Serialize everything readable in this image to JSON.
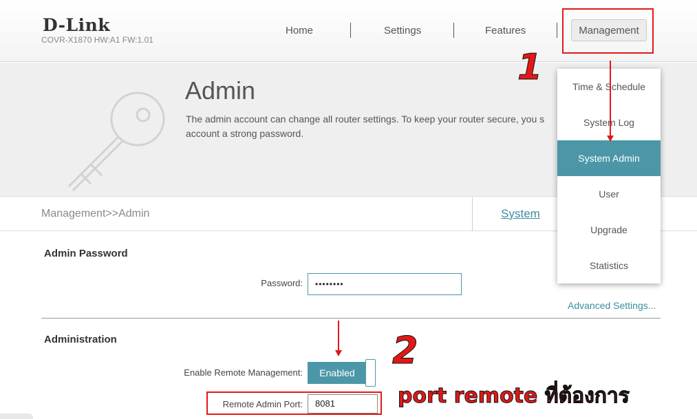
{
  "header": {
    "brand": "D-Link",
    "model": "COVR-X1870 HW:A1 FW:1.01",
    "nav": [
      "Home",
      "Settings",
      "Features",
      "Management"
    ]
  },
  "banner": {
    "title": "Admin",
    "description": "The admin account can change all router settings. To keep your router secure, you s account a strong password."
  },
  "breadcrumb": "Management>>Admin",
  "system_tab": "System",
  "dropdown": {
    "items": [
      "Time & Schedule",
      "System Log",
      "System Admin",
      "User",
      "Upgrade",
      "Statistics"
    ],
    "active": "System Admin"
  },
  "admin_password": {
    "title": "Admin Password",
    "label": "Password:",
    "value": "••••••••"
  },
  "advanced_link": "Advanced Settings...",
  "administration": {
    "title": "Administration",
    "remote_label": "Enable Remote Management:",
    "remote_value": "Enabled",
    "port_label": "Remote Admin Port:",
    "port_value": "8081"
  },
  "annotations": {
    "step1": "1",
    "step2": "2",
    "note": "port remote  ที่ต้องการ"
  },
  "colors": {
    "accent": "#4b97a8",
    "annotation_red": "#e21818"
  }
}
